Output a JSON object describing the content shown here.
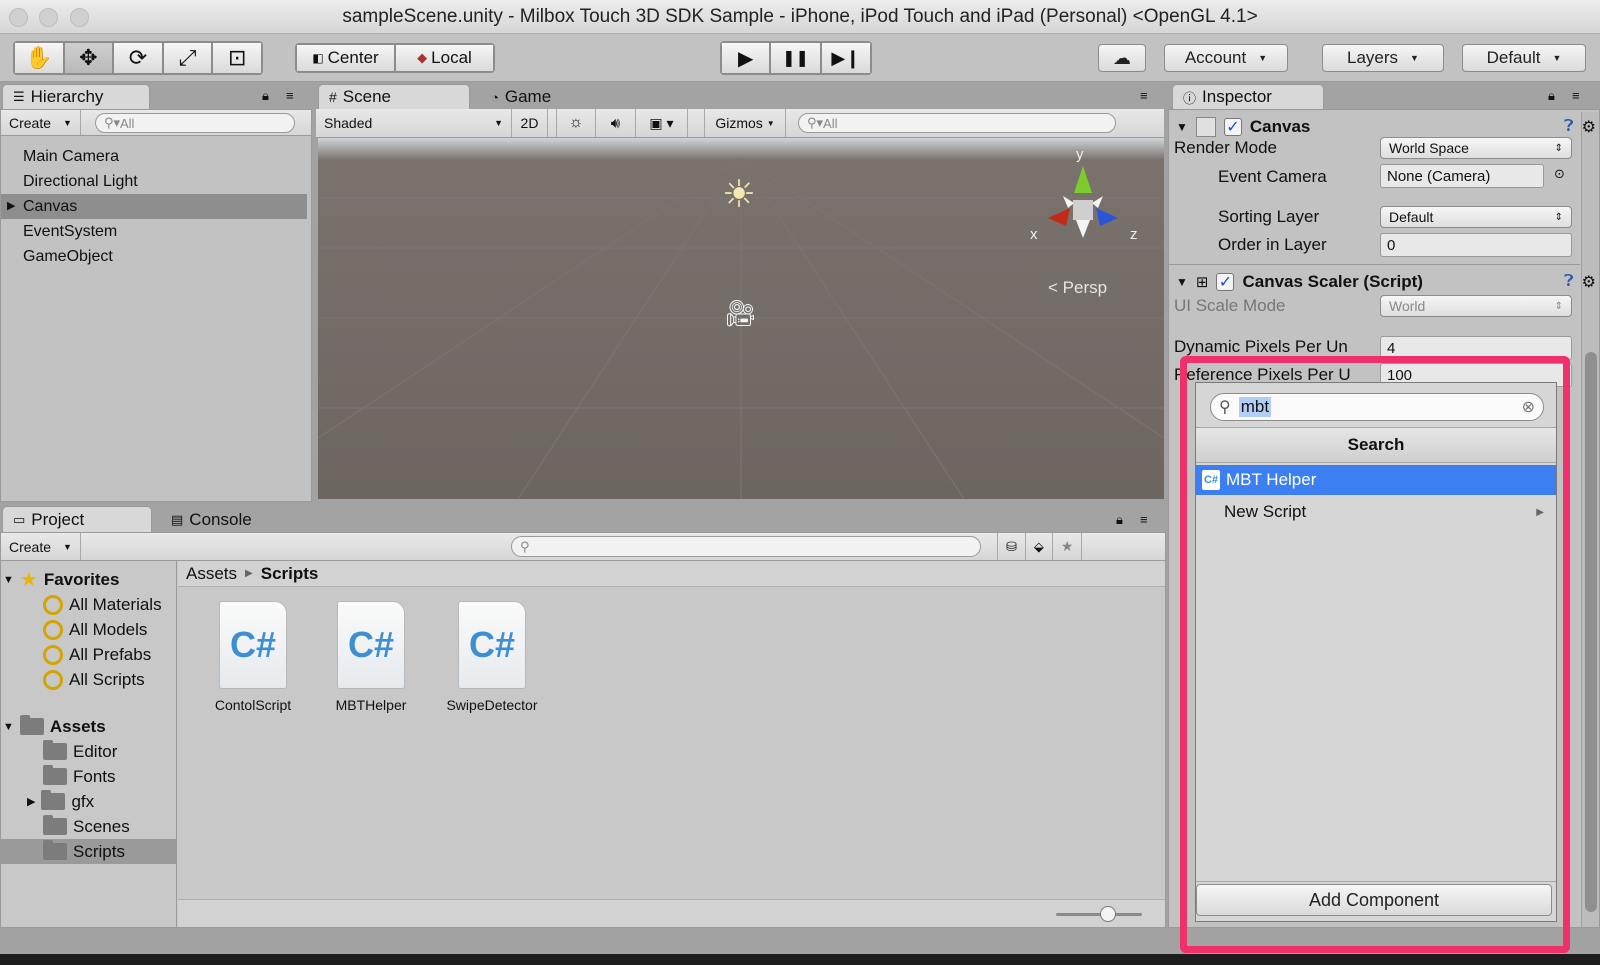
{
  "window": {
    "title": "sampleScene.unity - Milbox Touch 3D SDK Sample - iPhone, iPod Touch and iPad (Personal) <OpenGL 4.1>"
  },
  "toolbar": {
    "tools": [
      {
        "name": "hand-tool-icon",
        "glyph": "✋"
      },
      {
        "name": "move-tool-icon",
        "glyph": "✥"
      },
      {
        "name": "rotate-tool-icon",
        "glyph": "⟳"
      },
      {
        "name": "scale-tool-icon",
        "glyph": "⤢"
      },
      {
        "name": "rect-tool-icon",
        "glyph": "⊡"
      }
    ],
    "pivot_label": "Center",
    "space_label": "Local",
    "play": "▶",
    "pause": "❚❚",
    "step": "▶❙",
    "account_label": "Account",
    "layers_label": "Layers",
    "layout_label": "Default"
  },
  "hierarchy": {
    "tab": "Hierarchy",
    "create_label": "Create",
    "search_placeholder": "All",
    "items": [
      "Main Camera",
      "Directional Light",
      "Canvas",
      "EventSystem",
      "GameObject"
    ]
  },
  "scene": {
    "tab_scene": "Scene",
    "tab_game": "Game",
    "shading": "Shaded",
    "mode_2d": "2D",
    "gizmos": "Gizmos",
    "search_placeholder": "All",
    "persp_label": "Persp",
    "axis_y": "y",
    "axis_x": "x",
    "axis_z": "z"
  },
  "project": {
    "tab_project": "Project",
    "tab_console": "Console",
    "create_label": "Create",
    "favorites_label": "Favorites",
    "favorites": [
      "All Materials",
      "All Models",
      "All Prefabs",
      "All Scripts"
    ],
    "assets_label": "Assets",
    "folders": [
      "Editor",
      "Fonts",
      "gfx",
      "Scenes",
      "Scripts"
    ],
    "breadcrumb_root": "Assets",
    "breadcrumb_current": "Scripts",
    "files": [
      "ContolScript",
      "MBTHelper",
      "SwipeDetector"
    ],
    "file_glyph": "C#"
  },
  "inspector": {
    "tab": "Inspector",
    "canvas_title": "Canvas",
    "render_mode_label": "Render Mode",
    "render_mode_value": "World Space",
    "event_camera_label": "Event Camera",
    "event_camera_value": "None (Camera)",
    "sorting_layer_label": "Sorting Layer",
    "sorting_layer_value": "Default",
    "order_label": "Order in Layer",
    "order_value": "0",
    "scaler_title": "Canvas Scaler (Script)",
    "ui_scale_label": "UI Scale Mode",
    "ui_scale_value": "World",
    "dynamic_label": "Dynamic Pixels Per Un",
    "dynamic_value": "4",
    "reference_label": "Reference Pixels Per U",
    "reference_value": "100"
  },
  "add_component_popup": {
    "search_value": "mbt",
    "header": "Search",
    "results": [
      "MBT Helper"
    ],
    "new_script": "New Script",
    "add_button": "Add Component"
  },
  "colors": {
    "highlight_border": "#f0306a",
    "selection": "#3b7ff0"
  }
}
